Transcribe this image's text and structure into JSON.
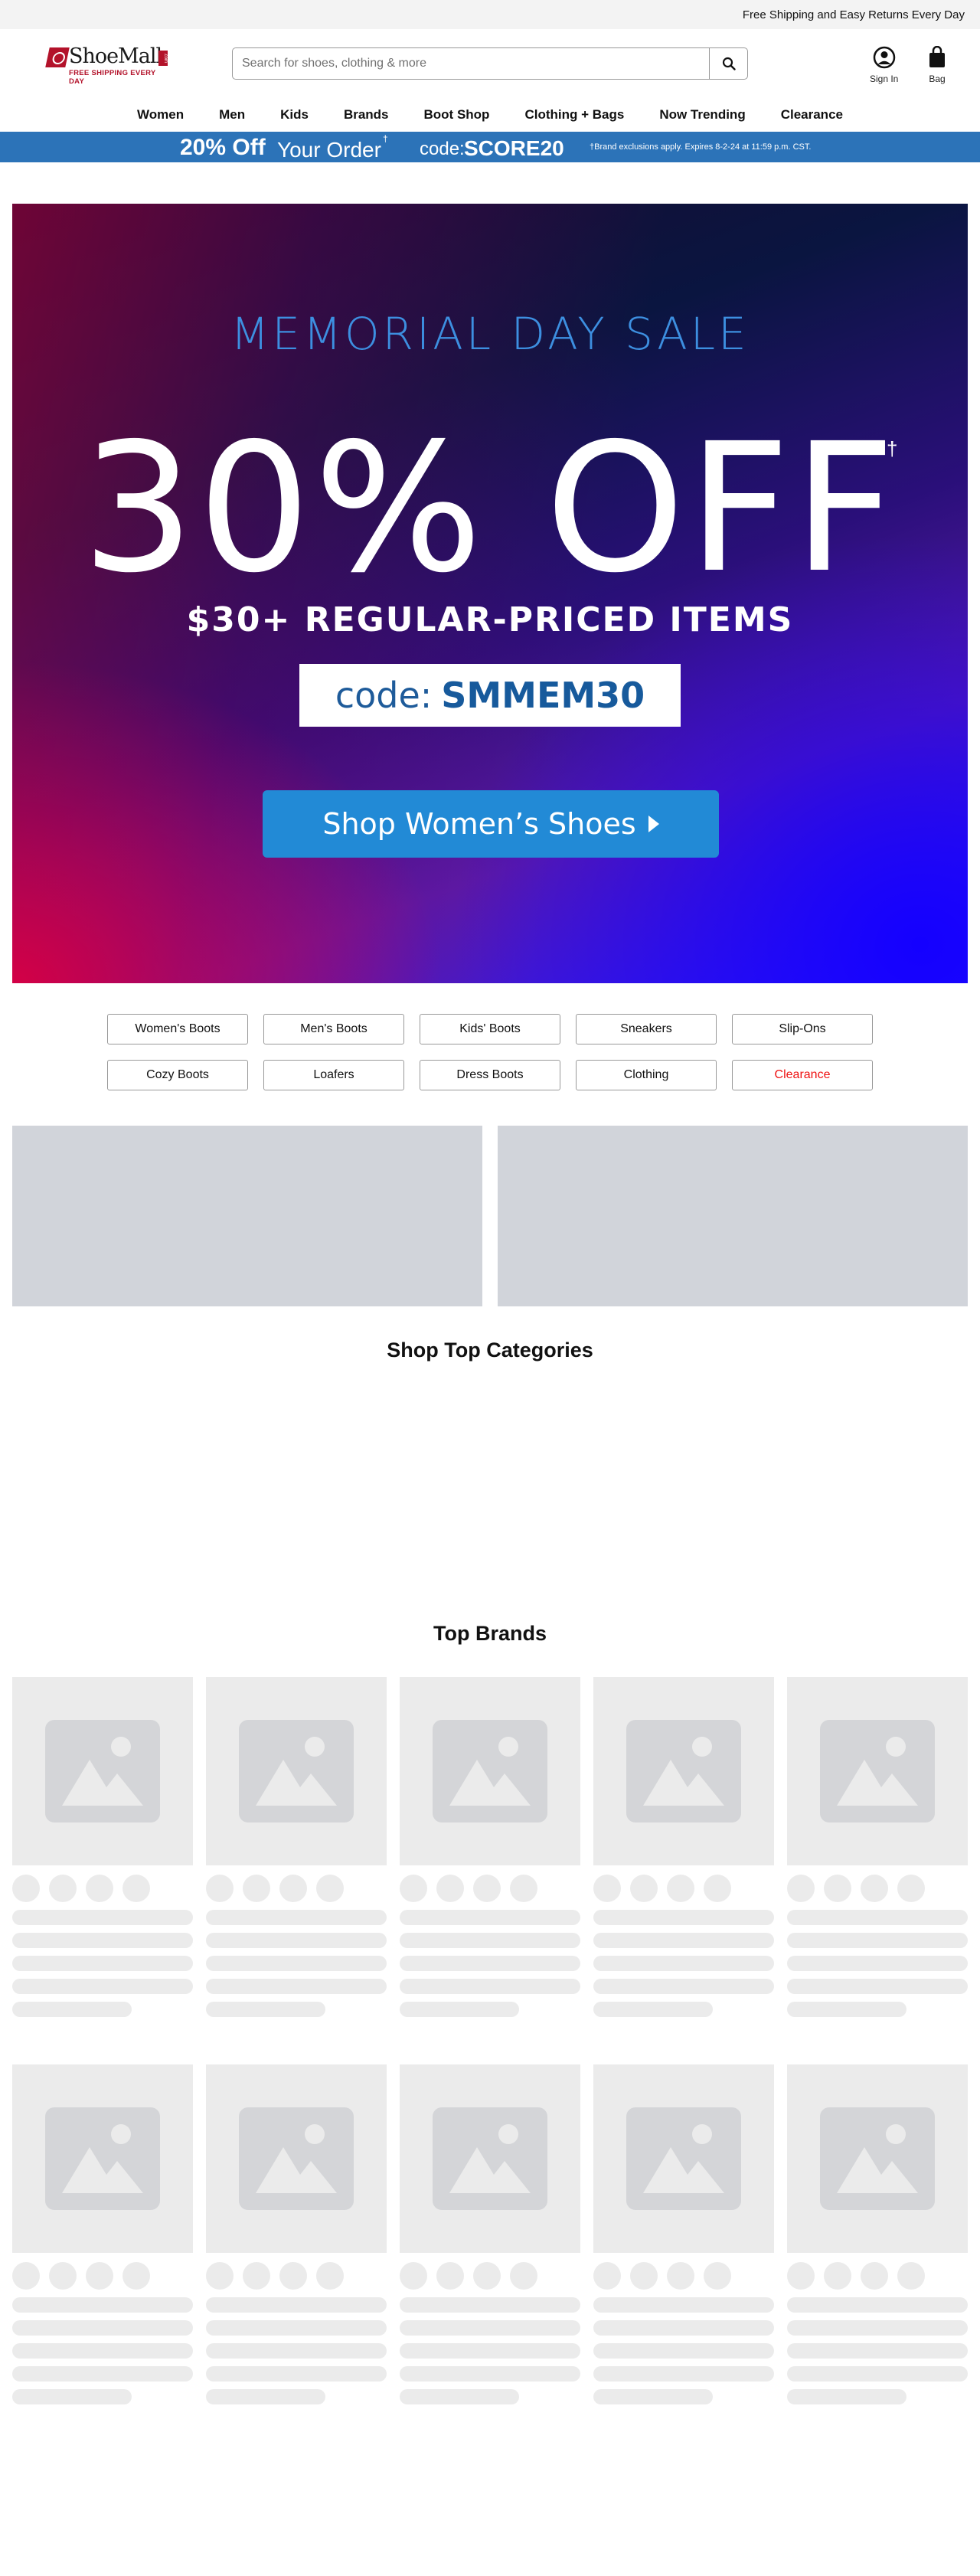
{
  "topbar": {
    "text": "Free Shipping and Easy Returns Every Day"
  },
  "logo": {
    "name": "ShoeMall",
    "tagline": "FREE SHIPPING EVERY DAY",
    "dotcom": ".com"
  },
  "search": {
    "placeholder": "Search for shoes, clothing & more",
    "value": ""
  },
  "header": {
    "signin_label": "Sign In",
    "bag_label": "Bag"
  },
  "nav": [
    "Women",
    "Men",
    "Kids",
    "Brands",
    "Boot Shop",
    "Clothing + Bags",
    "Now Trending",
    "Clearance"
  ],
  "promo": {
    "amount": "20% Off",
    "your_order": "Your Order",
    "dagger": "†",
    "code_label": "code:",
    "code": "SCORE20",
    "fine_print": "†Brand exclusions apply. Expires 8-2-24 at 11:59 p.m. CST."
  },
  "hero": {
    "title": "MEMORIAL DAY SALE",
    "headline": "30% OFF",
    "dagger": "†",
    "subline": "$30+ REGULAR-PRICED ITEMS",
    "code_label": "code:",
    "code": "SMMEM30",
    "cta": "Shop Women’s Shoes"
  },
  "chips": [
    {
      "label": "Women's Boots",
      "highlight": false
    },
    {
      "label": "Men's Boots",
      "highlight": false
    },
    {
      "label": "Kids' Boots",
      "highlight": false
    },
    {
      "label": "Sneakers",
      "highlight": false
    },
    {
      "label": "Slip-Ons",
      "highlight": false
    },
    {
      "label": "Cozy Boots",
      "highlight": false
    },
    {
      "label": "Loafers",
      "highlight": false
    },
    {
      "label": "Dress Boots",
      "highlight": false
    },
    {
      "label": "Clothing",
      "highlight": false
    },
    {
      "label": "Clearance",
      "highlight": true
    }
  ],
  "sections": {
    "top_categories": "Shop Top Categories",
    "top_brands": "Top Brands"
  },
  "colors": {
    "promo_bar": "#2c73b8",
    "hero_cta": "#228ad6",
    "clearance_red": "#ee1111",
    "placeholder_gray": "#ebebeb",
    "banner_gray": "#d1d4da"
  },
  "icons": {
    "search": "search-icon",
    "account": "user-circle-icon",
    "bag": "shopping-bag-icon",
    "image_placeholder": "image-placeholder-icon"
  }
}
